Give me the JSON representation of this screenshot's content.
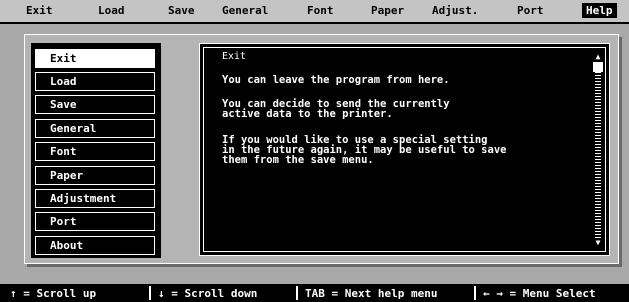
{
  "menu": {
    "items": [
      {
        "label": "Exit"
      },
      {
        "label": "Load"
      },
      {
        "label": "Save"
      },
      {
        "label": "General"
      },
      {
        "label": "Font"
      },
      {
        "label": "Paper"
      },
      {
        "label": "Adjust."
      },
      {
        "label": "Port"
      },
      {
        "label": "Help",
        "active": true
      }
    ]
  },
  "topics": {
    "items": [
      {
        "label": "Exit",
        "selected": true
      },
      {
        "label": "Load"
      },
      {
        "label": "Save"
      },
      {
        "label": "General"
      },
      {
        "label": "Font"
      },
      {
        "label": "Paper"
      },
      {
        "label": "Adjustment"
      },
      {
        "label": "Port"
      },
      {
        "label": "About"
      }
    ]
  },
  "help": {
    "title": "Exit",
    "para1": "You can leave the program from here.",
    "para2_line1": "You can decide to send the currently",
    "para2_line2": "active data to the printer.",
    "para3_line1": "If you would like to use a special setting",
    "para3_line2": "in the future again, it may be useful to save",
    "para3_line3": "them from the save menu.",
    "scroll_up_arrow": "▲",
    "scroll_down_arrow": "▼"
  },
  "status": {
    "scroll_up": "↑ = Scroll up",
    "scroll_down": "↓ = Scroll down",
    "tab": "TAB = Next help menu",
    "menu_select": "← → = Menu Select"
  },
  "colors": {
    "background": "#a8a8a8",
    "menubar": "#c4c4c4",
    "panel": "#000000",
    "text": "#ffffff"
  }
}
